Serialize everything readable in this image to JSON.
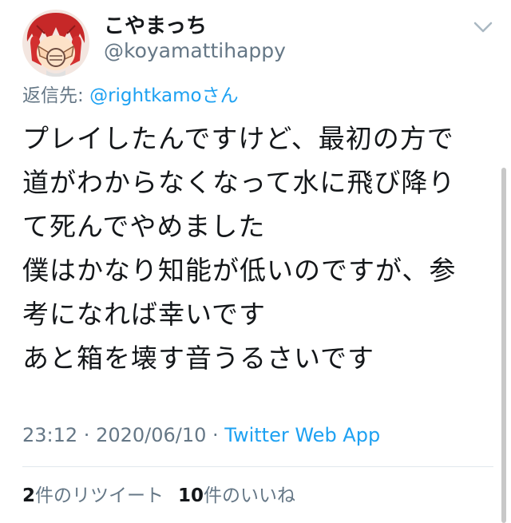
{
  "tweet": {
    "display_name": "こやまっち",
    "handle": "@koyamattihappy",
    "reply_prefix": "返信先: ",
    "reply_to": "@rightkamoさん",
    "body_lines": [
      "プレイしたんですけど、最初の方で",
      "道がわからなくなって水に飛び降り",
      "て死んでやめました",
      "僕はかなり知能が低いのですが、参",
      "考になれば幸いです",
      "あと箱を壊す音うるさいです"
    ],
    "time": "23:12",
    "separator": " · ",
    "date": "2020/06/10",
    "source": "Twitter Web App",
    "retweets": {
      "count": "2",
      "label": "件のリツイート"
    },
    "likes": {
      "count": "10",
      "label": "件のいいね"
    }
  },
  "icons": {
    "avatar": "avatar-anime-character",
    "menu": "chevron-down-icon"
  },
  "colors": {
    "text": "#14171a",
    "muted": "#657786",
    "link": "#1da1f2",
    "divider": "#e1e8ed"
  }
}
